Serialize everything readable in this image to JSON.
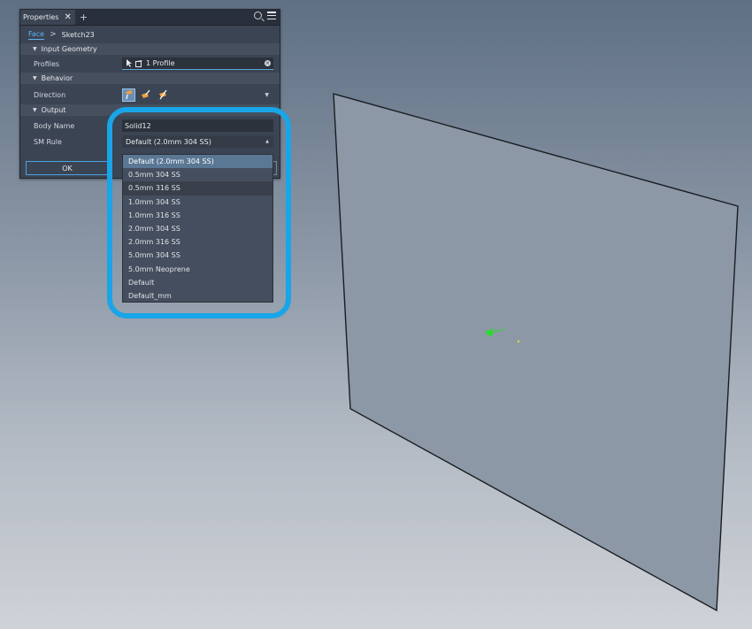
{
  "panel": {
    "tab_title": "Properties",
    "close_glyph": "✕",
    "add_glyph": "+",
    "breadcrumb": {
      "link": "Face",
      "separator": ">",
      "current": "Sketch23"
    },
    "sections": {
      "input_geometry": "Input Geometry",
      "behavior": "Behavior",
      "output": "Output"
    },
    "fields": {
      "profiles_label": "Profiles",
      "profiles_value": "1 Profile",
      "direction_label": "Direction",
      "body_name_label": "Body Name",
      "body_name_value": "Solid12",
      "sm_rule_label": "SM Rule",
      "sm_rule_value": "Default (2.0mm 304 SS)"
    },
    "ok_label": "OK"
  },
  "dropdown": {
    "options": [
      "Default (2.0mm 304 SS)",
      "0.5mm 304 SS",
      "0.5mm 316 SS",
      "1.0mm 304 SS",
      "1.0mm 316 SS",
      "2.0mm 304 SS",
      "2.0mm 316 SS",
      "5.0mm 304 SS",
      "5.0mm Neoprene",
      "Default",
      "Default_mm"
    ]
  },
  "colors": {
    "accent": "#19a5e8",
    "panel_bg": "#3b4453",
    "selected_option": "#5a7794",
    "triad_green": "#20e020"
  }
}
